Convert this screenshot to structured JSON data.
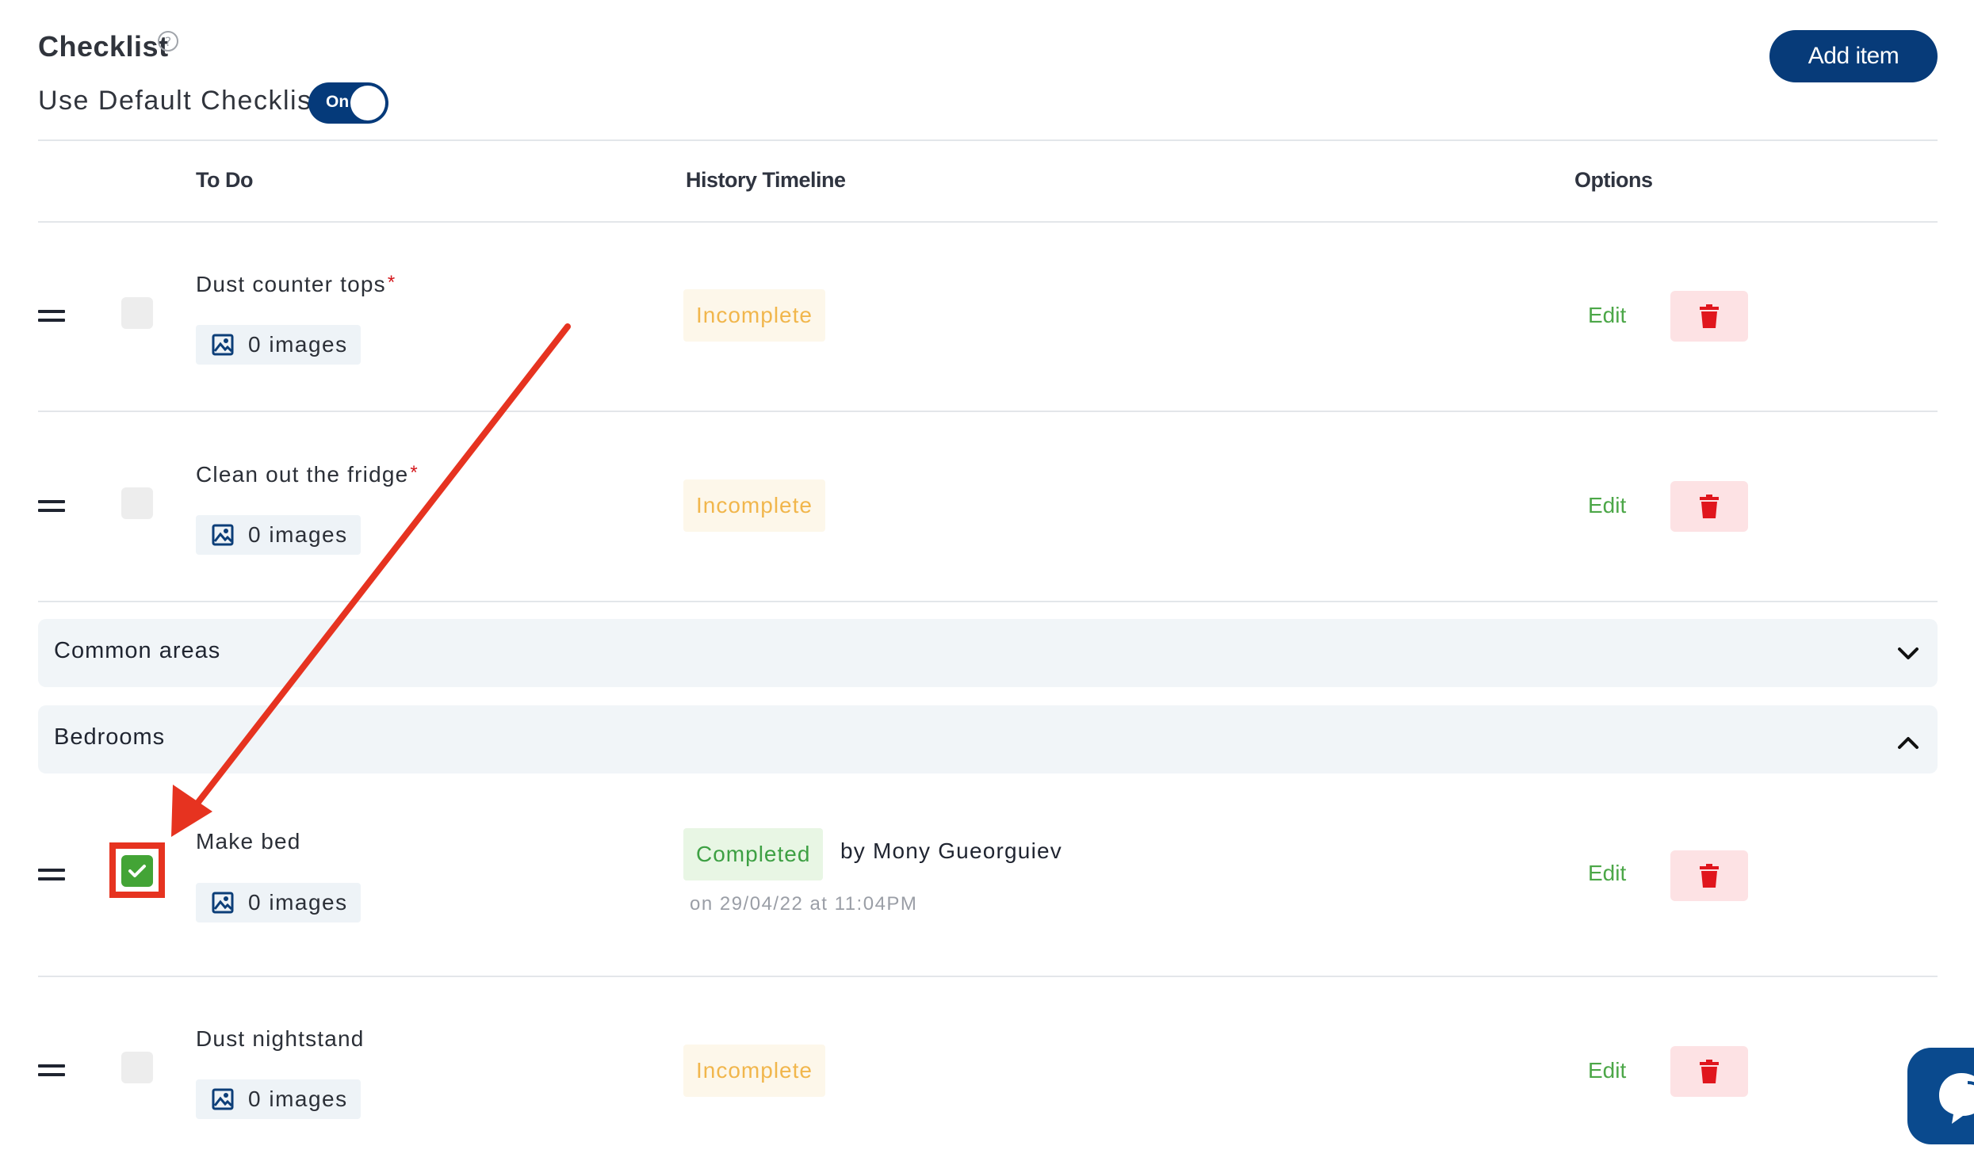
{
  "header": {
    "title": "Checklist",
    "default_label": "Use Default Checklist",
    "toggle_label": "On",
    "add_button": "Add item"
  },
  "columns": {
    "todo": "To Do",
    "history": "History Timeline",
    "options": "Options"
  },
  "rows": [
    {
      "title": "Dust counter tops",
      "required": "*",
      "images": "0 images",
      "status": "Incomplete",
      "edit": "Edit",
      "checked": false
    },
    {
      "title": "Clean out the fridge",
      "required": "*",
      "images": "0 images",
      "status": "Incomplete",
      "edit": "Edit",
      "checked": false
    }
  ],
  "sections": [
    {
      "label": "Common areas",
      "expanded": false
    },
    {
      "label": "Bedrooms",
      "expanded": true
    }
  ],
  "bedroom_rows": [
    {
      "title": "Make bed",
      "images": "0 images",
      "status": "Completed",
      "by": "by Mony Gueorguiev",
      "when": "on 29/04/22 at 11:04PM",
      "edit": "Edit",
      "checked": true
    },
    {
      "title": "Dust nightstand",
      "images": "0 images",
      "status": "Incomplete",
      "edit": "Edit",
      "checked": false
    }
  ],
  "colors": {
    "primary": "#073b79",
    "complete": "#43a436",
    "incomplete": "#f1b64c",
    "danger": "#d4161b",
    "annotation": "#e63320"
  },
  "icons": [
    "help-circle-icon",
    "drag-handle-icon",
    "image-icon",
    "trash-icon",
    "chevron-down-icon",
    "chevron-up-icon",
    "check-icon",
    "chat-icon"
  ]
}
